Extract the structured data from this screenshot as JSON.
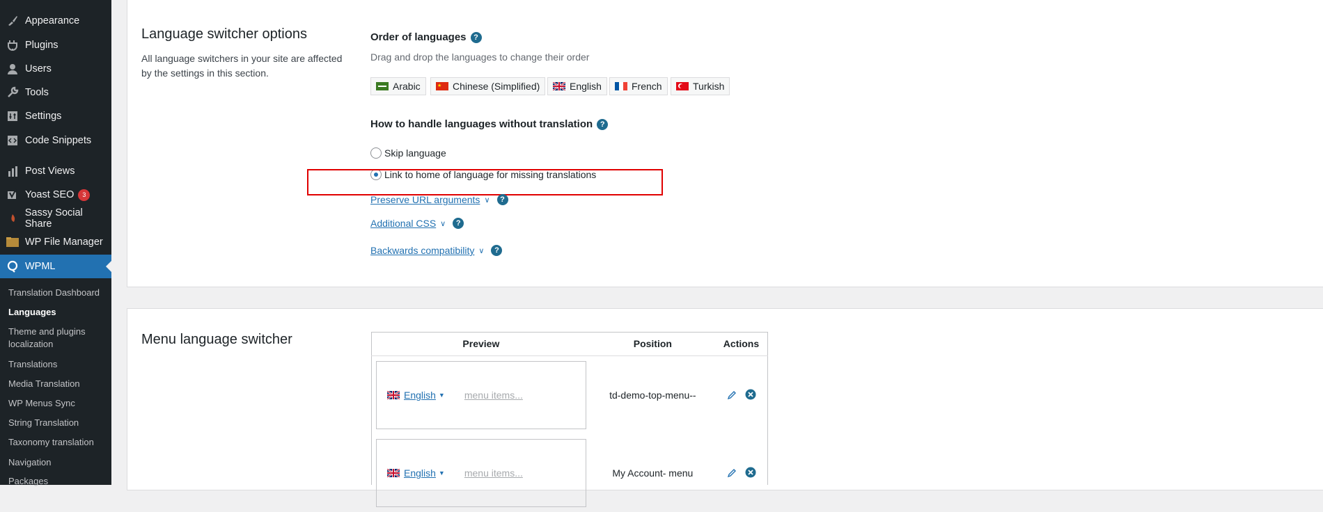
{
  "sidebar": {
    "menu": [
      {
        "label": "Appearance",
        "icon": "paintbrush-icon"
      },
      {
        "label": "Plugins",
        "icon": "plugin-icon"
      },
      {
        "label": "Users",
        "icon": "users-icon"
      },
      {
        "label": "Tools",
        "icon": "wrench-icon"
      },
      {
        "label": "Settings",
        "icon": "settings-icon"
      },
      {
        "label": "Code Snippets",
        "icon": "code-icon"
      },
      {
        "label": "Post Views",
        "icon": "bar-chart-icon"
      },
      {
        "label": "Yoast SEO",
        "icon": "yoast-icon",
        "badge": "3"
      },
      {
        "label": "Sassy Social Share",
        "icon": "share-icon"
      },
      {
        "label": "WP File Manager",
        "icon": "folder-icon"
      },
      {
        "label": "WPML",
        "icon": "wpml-icon"
      }
    ],
    "submenu": [
      "Translation Dashboard",
      "Languages",
      "Theme and plugins localization",
      "Translations",
      "Media Translation",
      "WP Menus Sync",
      "String Translation",
      "Taxonomy translation",
      "Navigation",
      "Packages"
    ]
  },
  "switcher_options": {
    "title": "Language switcher options",
    "description": "All language switchers in your site are affected by the settings in this section.",
    "order_title": "Order of languages",
    "order_hint": "Drag and drop the languages to change their order",
    "languages": [
      {
        "label": "Arabic",
        "flag": "sa"
      },
      {
        "label": "Chinese (Simplified)",
        "flag": "cn"
      },
      {
        "label": "English",
        "flag": "gb"
      },
      {
        "label": "French",
        "flag": "fr"
      },
      {
        "label": "Turkish",
        "flag": "tr"
      }
    ],
    "missing_title": "How to handle languages without translation",
    "options": [
      {
        "label": "Skip language",
        "checked": false
      },
      {
        "label": "Link to home of language for missing translations",
        "checked": true
      }
    ],
    "links": [
      "Preserve URL arguments",
      "Additional CSS",
      "Backwards compatibility"
    ],
    "help_glyph": "?"
  },
  "menu_switcher": {
    "title": "Menu language switcher",
    "headers": {
      "preview": "Preview",
      "position": "Position",
      "actions": "Actions"
    },
    "rows": [
      {
        "lang": "English",
        "menu_items": "menu items...",
        "position": "td-demo-top-menu--"
      },
      {
        "lang": "English",
        "menu_items": "menu items...",
        "position": "My Account- menu"
      }
    ]
  },
  "colors": {
    "accent": "#2271b1",
    "sidebar_bg": "#1d2327",
    "help": "#1f6b8f",
    "highlight": "#e00000"
  }
}
